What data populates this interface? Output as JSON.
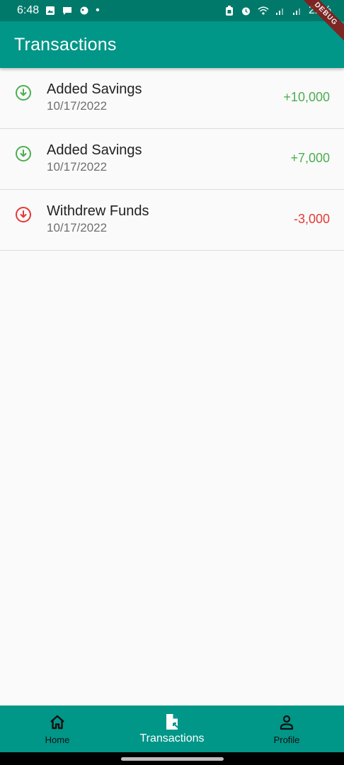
{
  "status_bar": {
    "time": "6:48",
    "dot": "•",
    "battery": "22%",
    "icons_left": [
      "image-icon",
      "chat-icon",
      "hand-icon"
    ],
    "icons_right": [
      "battery-saver-icon",
      "alarm-icon",
      "wifi-icon",
      "signal-icon",
      "signal-icon"
    ]
  },
  "app_bar": {
    "title": "Transactions",
    "debug_banner": "DEBUG"
  },
  "transactions": [
    {
      "title": "Added Savings",
      "date": "10/17/2022",
      "amount": "+10,000",
      "type": "deposit",
      "icon": "arrow-down-circle-icon",
      "color": "#4caf50"
    },
    {
      "title": "Added Savings",
      "date": "10/17/2022",
      "amount": "+7,000",
      "type": "deposit",
      "icon": "arrow-down-circle-icon",
      "color": "#4caf50"
    },
    {
      "title": "Withdrew Funds",
      "date": "10/17/2022",
      "amount": "-3,000",
      "type": "withdrawal",
      "icon": "arrow-down-circle-icon",
      "color": "#e53935"
    }
  ],
  "bottom_nav": {
    "items": [
      {
        "label": "Home",
        "icon": "home-icon",
        "active": false
      },
      {
        "label": "Transactions",
        "icon": "document-icon",
        "active": true
      },
      {
        "label": "Profile",
        "icon": "person-icon",
        "active": false
      }
    ]
  },
  "colors": {
    "primary": "#009688",
    "status_bar": "#00796b",
    "positive": "#4caf50",
    "negative": "#e53935",
    "background": "#fafafa"
  }
}
